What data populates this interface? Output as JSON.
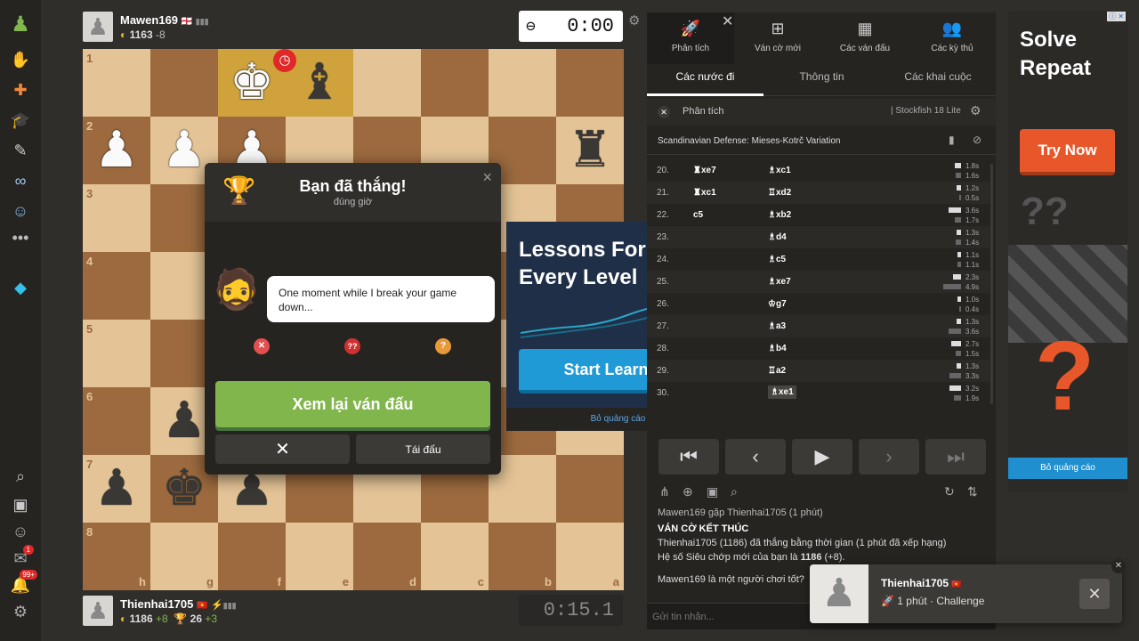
{
  "sidebar": {
    "icons": [
      "pawn-logo-icon",
      "play-icon",
      "puzzle-icon",
      "learn-icon",
      "watch-icon",
      "social-icon",
      "friends-icon",
      "more-icon",
      "diamond-icon",
      "search-icon",
      "profile-icon",
      "friends-icon",
      "messages-icon",
      "notifications-icon",
      "settings-icon"
    ],
    "badges": {
      "messages": "1",
      "notifications": "99+"
    }
  },
  "top_player": {
    "name": "Mawen169",
    "flag": "🏴󠁧󠁢󠁥󠁮󠁧󠁿",
    "rating": "1163",
    "delta": "-8",
    "clock": "0:00"
  },
  "bottom_player": {
    "name": "Thienhai1705",
    "flag": "🇻🇳",
    "rating": "1186",
    "delta": "+8",
    "trophy": "26",
    "trophy_delta": "+3",
    "clock": "0:15.1"
  },
  "board": {
    "ranks": [
      "1",
      "2",
      "3",
      "4",
      "5",
      "6",
      "7",
      "8"
    ],
    "files": [
      "h",
      "g",
      "f",
      "e",
      "d",
      "c",
      "b",
      "a"
    ],
    "pieces": [
      {
        "sq": "1-3",
        "p": "♚",
        "c": "w"
      },
      {
        "sq": "1-4",
        "p": "♝",
        "c": "b"
      },
      {
        "sq": "2-1",
        "p": "♟",
        "c": "w"
      },
      {
        "sq": "2-2",
        "p": "♟",
        "c": "w"
      },
      {
        "sq": "2-3",
        "p": "♟",
        "c": "w"
      },
      {
        "sq": "2-8",
        "p": "♜",
        "c": "b"
      },
      {
        "sq": "6-2",
        "p": "♟",
        "c": "b"
      },
      {
        "sq": "7-1",
        "p": "♟",
        "c": "b"
      },
      {
        "sq": "7-2",
        "p": "♚",
        "c": "b"
      },
      {
        "sq": "7-3",
        "p": "♟",
        "c": "b"
      }
    ]
  },
  "modal": {
    "title": "Bạn đã thắng!",
    "subtitle": "đúng giờ",
    "coach_message": "One moment while I break your game down...",
    "review_label": "Xem lại ván đấu",
    "rematch_label": "Tái đấu",
    "marks": [
      "✕",
      "??",
      "?"
    ]
  },
  "ad_center": {
    "headline": "Lessons For Every Level",
    "cta": "Start Learning",
    "remove": "Bỏ quảng cáo"
  },
  "panel": {
    "tabs": [
      "Phân tích",
      "Ván cờ mới",
      "Các ván đấu",
      "Các kỳ thủ"
    ],
    "subtabs": [
      "Các nước đi",
      "Thông tin",
      "Các khai cuộc"
    ],
    "analysis_label": "Phân tích",
    "engine": "Stockfish 18 Lite",
    "opening": "Scandinavian Defense: Mieses-Kotrč Variation",
    "moves": [
      {
        "n": "20.",
        "w": "xe7",
        "b": "xc1",
        "t1": "1.8s",
        "t2": "1.6s",
        "wi": "♜",
        "bi": "♗"
      },
      {
        "n": "21.",
        "w": "xc1",
        "b": "xd2",
        "t1": "1.2s",
        "t2": "0.5s",
        "wi": "♜",
        "bi": "♖"
      },
      {
        "n": "22.",
        "w": "c5",
        "b": "xb2",
        "t1": "3.6s",
        "t2": "1.7s",
        "wi": "",
        "bi": "♗"
      },
      {
        "n": "23.",
        "w": "",
        "b": "d4",
        "t1": "1.3s",
        "t2": "1.4s",
        "wi": "",
        "bi": "♗"
      },
      {
        "n": "24.",
        "w": "",
        "b": "c5",
        "t1": "1.1s",
        "t2": "1.1s",
        "wi": "",
        "bi": "♗"
      },
      {
        "n": "25.",
        "w": "",
        "b": "xe7",
        "t1": "2.3s",
        "t2": "4.9s",
        "wi": "",
        "bi": "♗"
      },
      {
        "n": "26.",
        "w": "",
        "b": "g7",
        "t1": "1.0s",
        "t2": "0.4s",
        "wi": "",
        "bi": "♔"
      },
      {
        "n": "27.",
        "w": "",
        "b": "a3",
        "t1": "1.3s",
        "t2": "3.6s",
        "wi": "",
        "bi": "♗"
      },
      {
        "n": "28.",
        "w": "",
        "b": "b4",
        "t1": "2.7s",
        "t2": "1.5s",
        "wi": "",
        "bi": "♗"
      },
      {
        "n": "29.",
        "w": "",
        "b": "a2",
        "t1": "1.3s",
        "t2": "3.3s",
        "wi": "",
        "bi": "♖"
      },
      {
        "n": "30.",
        "w": "",
        "b": "xe1",
        "t1": "3.2s",
        "t2": "1.9s",
        "wi": "",
        "bi": "♗"
      }
    ],
    "chat": {
      "line0": "Mawen169 gặp Thienhai1705 (1 phút)",
      "result_title": "VÁN CỜ KẾT THÚC",
      "result_line": "Thienhai1705 (1186) đã thắng bằng thời gian (1 phút đã xếp hạng)",
      "rating_line_pre": "Hệ số Siêu chớp mới của bạn là ",
      "rating_line_val": "1186",
      "rating_line_post": " (+8).",
      "question": "Mawen169 là một người chơi tốt?",
      "placeholder": "Gửi tin nhắn..."
    }
  },
  "right_ad": {
    "headline": "Solve Repeat",
    "cta": "Try Now",
    "remove": "Bỏ quảng cáo"
  },
  "toast": {
    "name": "Thienhai1705",
    "detail": "1 phút · Challenge"
  }
}
